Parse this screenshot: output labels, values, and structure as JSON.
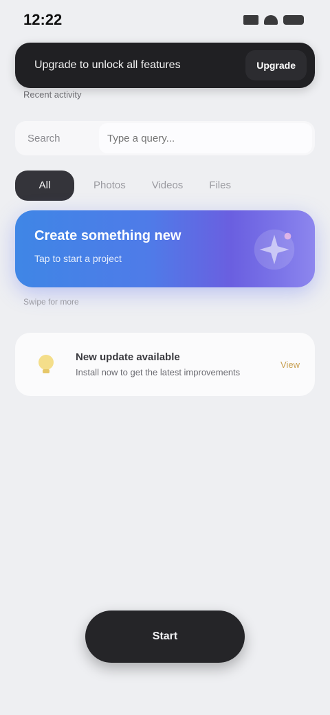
{
  "status_bar": {
    "time": "12:22"
  },
  "promo": {
    "text": "Upgrade to unlock all features",
    "cta": "Upgrade"
  },
  "section": {
    "caption": "Recent activity"
  },
  "input": {
    "label": "Search",
    "placeholder": "Type a query..."
  },
  "tabs": [
    {
      "label": "All"
    },
    {
      "label": "Photos"
    },
    {
      "label": "Videos"
    },
    {
      "label": "Files"
    }
  ],
  "hero": {
    "title": "Create something new",
    "subtitle": "Tap to start a project"
  },
  "hint": {
    "text": "Swipe for more"
  },
  "notice": {
    "title": "New update available",
    "description": "Install now to get the latest improvements",
    "action": "View"
  },
  "home_pill": {
    "label": "Start"
  },
  "colors": {
    "background": "#eeeff2",
    "dark_surface": "#202023",
    "accent_blue": "#3f86e6",
    "accent_purple": "#7b74e8",
    "notice_accent": "#f2d26a"
  },
  "icons": {
    "notice": "lightbulb-icon",
    "hero": "sparkle-icon"
  }
}
